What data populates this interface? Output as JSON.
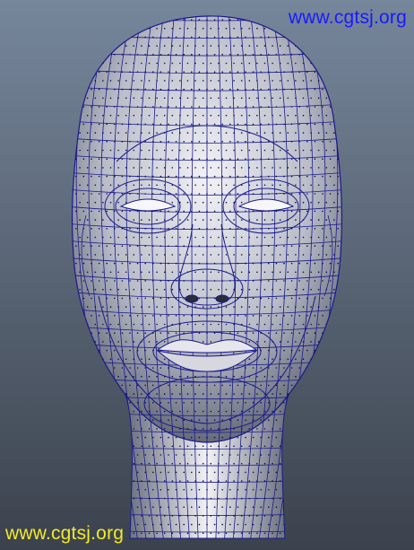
{
  "viewport": {
    "subject": "head-wireframe-mesh",
    "colors": {
      "background_top": "#76869b",
      "background_bottom": "#3b424d",
      "skin_light": "#f2f2f6",
      "skin_mid": "#b9bcc8",
      "skin_dark": "#666b7a",
      "wire": "#1a1a8c",
      "vertex": "#101040"
    }
  },
  "watermarks": {
    "top": {
      "text": "www.cgtsj.org",
      "color": "#1a1aff"
    },
    "bottom": {
      "text": "www.cgtsj.org",
      "color": "#f2ea2a"
    }
  }
}
